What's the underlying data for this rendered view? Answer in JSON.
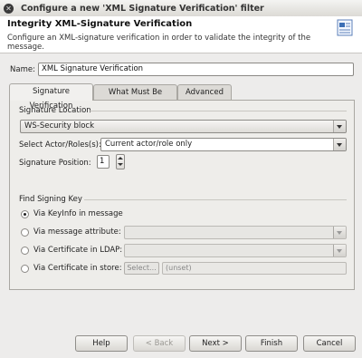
{
  "window": {
    "title": "Configure a new 'XML Signature Verification' filter"
  },
  "header": {
    "title": "Integrity XML-Signature Verification",
    "description": "Configure an XML-signature verification in order to validate the integrity of the message."
  },
  "name_field": {
    "label": "Name:",
    "value": "XML Signature Verification"
  },
  "tabs": [
    {
      "label": "Signature Verification",
      "active": true
    },
    {
      "label": "What Must Be Signed",
      "active": false
    },
    {
      "label": "Advanced",
      "active": false
    }
  ],
  "signature_location": {
    "group_label": "Signature Location",
    "location_value": "WS-Security block",
    "actor_label": "Select Actor/Roles(s):",
    "actor_value": "Current actor/role only",
    "position_label": "Signature Position:",
    "position_value": "1"
  },
  "find_signing_key": {
    "group_label": "Find Signing Key",
    "options": [
      {
        "label": "Via KeyInfo in message",
        "selected": true
      },
      {
        "label": "Via message attribute:",
        "selected": false
      },
      {
        "label": "Via Certificate in LDAP:",
        "selected": false
      },
      {
        "label": "Via Certificate in store:",
        "selected": false
      }
    ],
    "select_button": "Select...",
    "unset_value": "(unset)"
  },
  "buttons": {
    "help": "Help",
    "back": "< Back",
    "next": "Next >",
    "finish": "Finish",
    "cancel": "Cancel"
  }
}
